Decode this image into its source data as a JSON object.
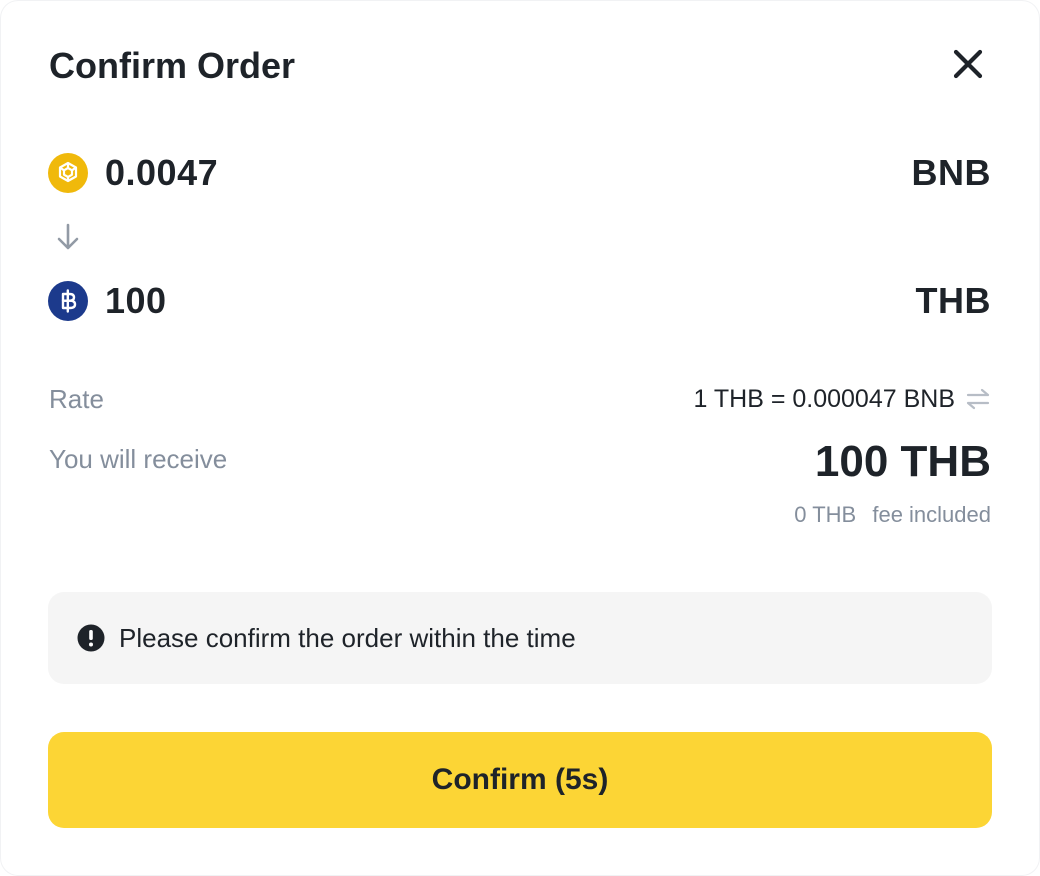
{
  "dialog": {
    "title": "Confirm Order",
    "close_icon": "close-icon"
  },
  "from": {
    "amount": "0.0047",
    "currency": "BNB",
    "icon": "bnb-coin-icon",
    "icon_color": "#F0B90B"
  },
  "to": {
    "amount": "100",
    "currency": "THB",
    "icon": "thb-coin-icon",
    "icon_color": "#1C3A8C"
  },
  "rate": {
    "label": "Rate",
    "value": "1 THB = 0.000047 BNB",
    "icon": "swap-icon"
  },
  "receive": {
    "label": "You will receive",
    "amount": "100 THB",
    "fee_amount": "0 THB",
    "fee_label": "fee included"
  },
  "notice": {
    "icon": "exclamation-circle-icon",
    "text": "Please confirm the order within the time"
  },
  "confirm_button": {
    "label": "Confirm (5s)",
    "color": "#FCD535"
  }
}
